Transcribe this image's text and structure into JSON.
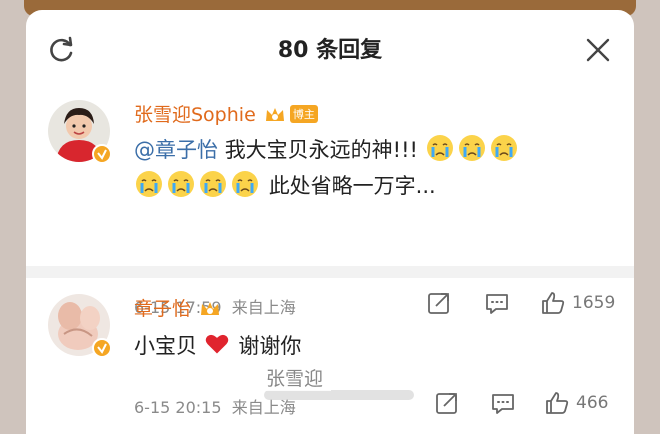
{
  "header": {
    "title": "80 条回复"
  },
  "comments": [
    {
      "user": "张雪迎Sophie",
      "badge": "博主",
      "mention": "@章子怡",
      "text_line1": "我大宝贝永远的神!!!",
      "text_line2": "此处省略一万字...",
      "date": "6-15 17:59",
      "location": "来自上海",
      "likes": "1659"
    },
    {
      "user": "章子怡",
      "text_before": "小宝贝",
      "text_after": "谢谢你",
      "date": "6-15 20:15",
      "location": "来自上海",
      "likes": "466"
    }
  ],
  "watermark": {
    "text": "张雪迎"
  },
  "colors": {
    "username": "#e06a1c",
    "mention": "#3b6ea8",
    "heart": "#e0242e",
    "badge": "#f5a623"
  },
  "icons": [
    "refresh-icon",
    "close-icon",
    "crown-icon",
    "verified-icon",
    "crying-emoji-icon",
    "share-icon",
    "comment-icon",
    "like-icon",
    "heart-icon"
  ]
}
